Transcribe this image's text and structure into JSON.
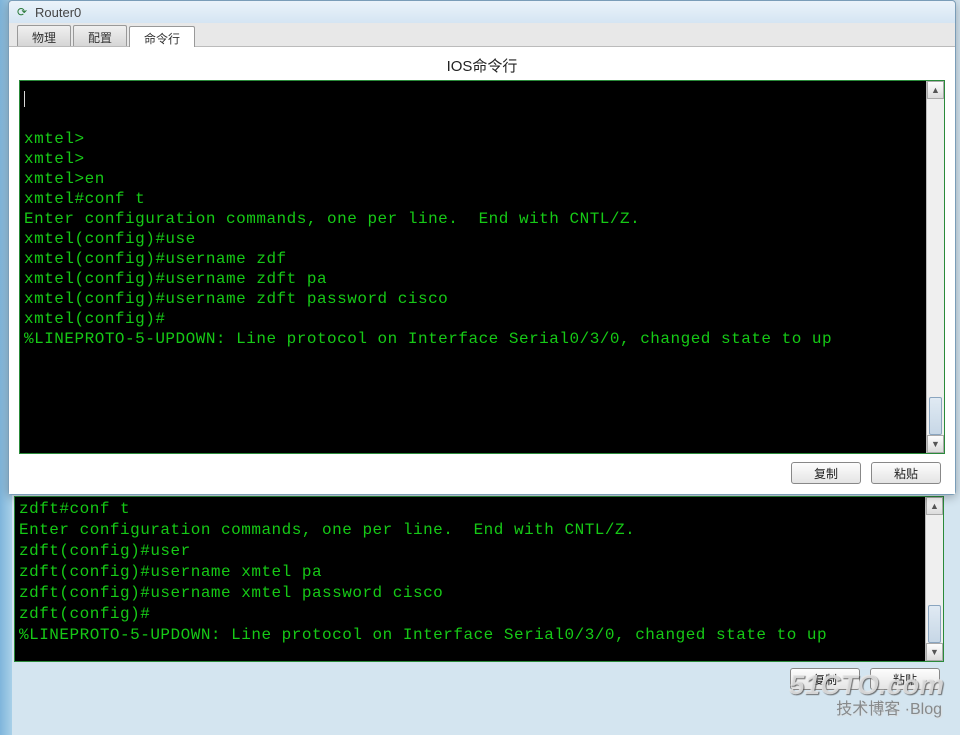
{
  "window": {
    "title": "Router0"
  },
  "tabs": {
    "physical": "物理",
    "config": "配置",
    "cli": "命令行"
  },
  "panel": {
    "heading": "IOS命令行"
  },
  "terminal_main": {
    "lines": "\n\nxmtel>\nxmtel>\nxmtel>en\nxmtel#conf t\nEnter configuration commands, one per line.  End with CNTL/Z.\nxmtel(config)#use\nxmtel(config)#username zdf\nxmtel(config)#username zdft pa\nxmtel(config)#username zdft password cisco\nxmtel(config)#\n%LINEPROTO-5-UPDOWN: Line protocol on Interface Serial0/3/0, changed state to up"
  },
  "terminal_bg": {
    "lines": "zdft#conf t\nEnter configuration commands, one per line.  End with CNTL/Z.\nzdft(config)#user\nzdft(config)#username xmtel pa\nzdft(config)#username xmtel password cisco\nzdft(config)#\n%LINEPROTO-5-UPDOWN: Line protocol on Interface Serial0/3/0, changed state to up"
  },
  "buttons": {
    "copy": "复制",
    "paste": "粘贴"
  },
  "watermark": {
    "main": "51CTO.com",
    "sub": "技术博客 ·Blog"
  },
  "colors": {
    "terminal_fg": "#16c916",
    "terminal_bg": "#000000",
    "border": "#2a8a3a"
  }
}
